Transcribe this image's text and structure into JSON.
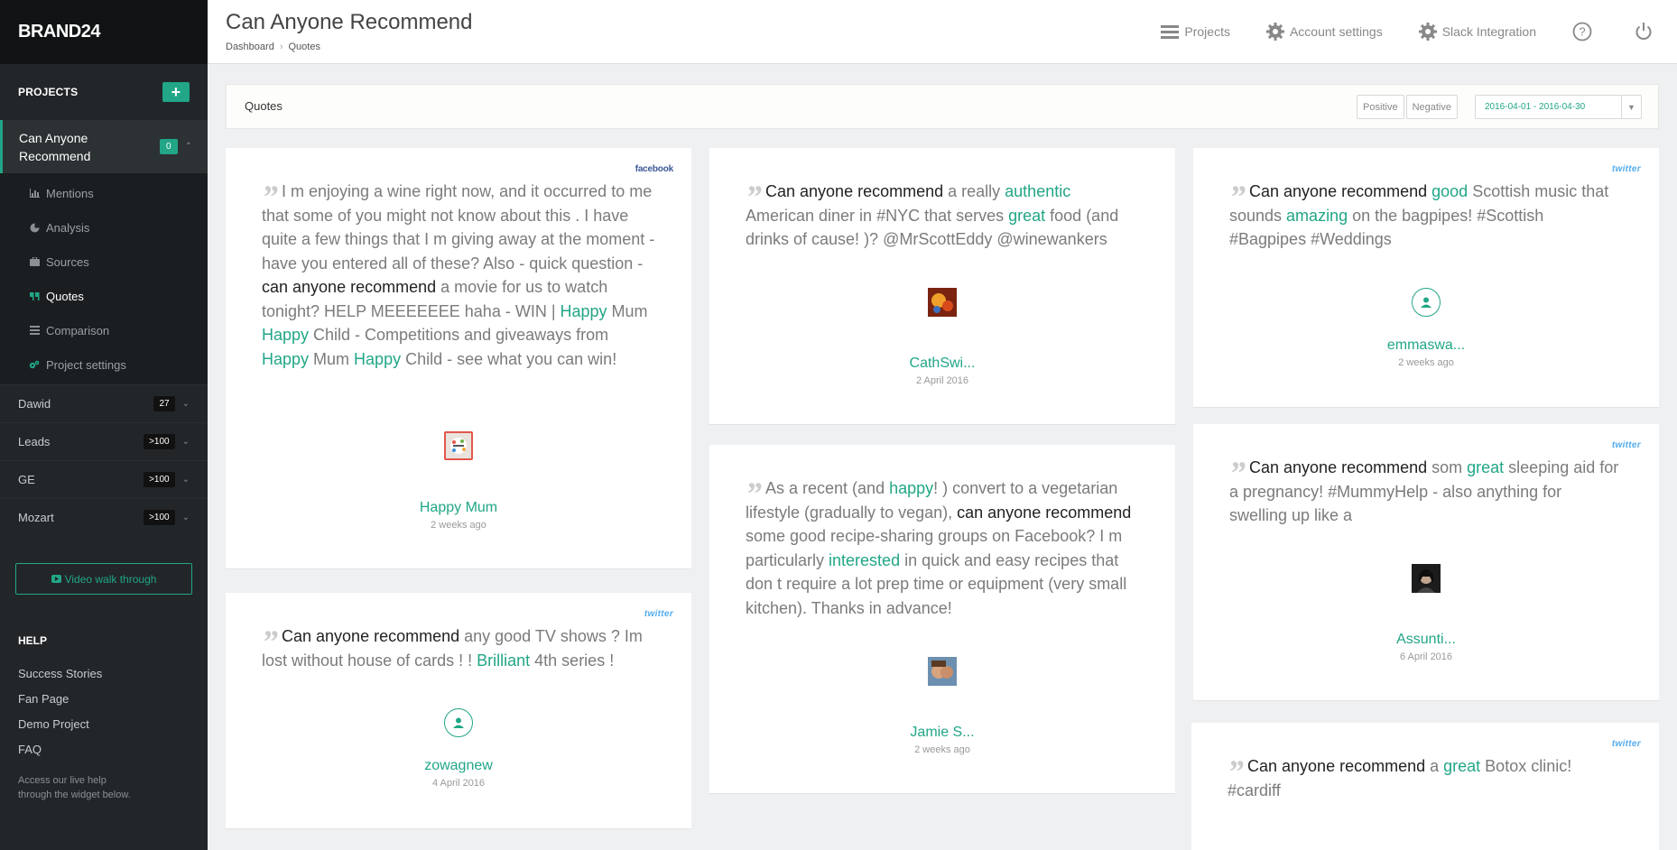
{
  "brand": "BRAND24",
  "sidebar": {
    "projects_heading": "PROJECTS",
    "add_label": "+",
    "active_project": {
      "name": "Can Anyone Recommend",
      "badge": "0"
    },
    "submenu": [
      {
        "label": "Mentions",
        "icon": "bar-chart-icon"
      },
      {
        "label": "Analysis",
        "icon": "pie-chart-icon"
      },
      {
        "label": "Sources",
        "icon": "briefcase-icon"
      },
      {
        "label": "Quotes",
        "icon": "quote-icon"
      },
      {
        "label": "Comparison",
        "icon": "list-icon"
      },
      {
        "label": "Project settings",
        "icon": "gears-icon"
      }
    ],
    "projects": [
      {
        "name": "Dawid",
        "badge": "27"
      },
      {
        "name": "Leads",
        "badge": ">100"
      },
      {
        "name": "GE",
        "badge": ">100"
      },
      {
        "name": "Mozart",
        "badge": ">100"
      }
    ],
    "video_label": "Video walk through",
    "help_heading": "HELP",
    "help_links": [
      "Success Stories",
      "Fan Page",
      "Demo Project",
      "FAQ"
    ],
    "help_note": "Access our live help through the widget below."
  },
  "header": {
    "title": "Can Anyone Recommend",
    "breadcrumb": [
      "Dashboard",
      "Quotes"
    ],
    "nav": {
      "projects": "Projects",
      "account": "Account settings",
      "slack": "Slack Integration"
    }
  },
  "filter": {
    "title": "Quotes",
    "positive": "Positive",
    "negative": "Negative",
    "date_range": "2016-04-01 - 2016-04-30"
  },
  "quotes": [
    {
      "source": "facebook",
      "author": "Happy Mum",
      "date": "2 weeks ago"
    },
    {
      "source": "twitter",
      "author": "zowagnew",
      "date": "4 April 2016"
    },
    {
      "source": "",
      "author": "CathSwi...",
      "date": "2 April 2016"
    },
    {
      "source": "",
      "author": "Jamie S...",
      "date": "2 weeks ago"
    },
    {
      "source": "twitter",
      "author": "emmaswa...",
      "date": "2 weeks ago"
    },
    {
      "source": "twitter",
      "author": "Assunti...",
      "date": "6 April 2016"
    },
    {
      "source": "twitter",
      "author": "",
      "date": ""
    }
  ],
  "quote_texts": {
    "q0": [
      {
        "t": "I m enjoying a wine right now, and it occurred to me that some of you might not know about this . I have quite a few things that I m giving away at the moment - have you entered all of these? Also - quick question - "
      },
      {
        "b": "can anyone recommend"
      },
      {
        "t": " a movie for us to watch tonight? HELP MEEEEEEE haha - WIN | "
      },
      {
        "g": "Happy"
      },
      {
        "t": " Mum "
      },
      {
        "g": "Happy"
      },
      {
        "t": " Child - Competitions and giveaways from "
      },
      {
        "g": "Happy"
      },
      {
        "t": " Mum "
      },
      {
        "g": "Happy"
      },
      {
        "t": " Child - see what you can win!"
      }
    ],
    "q1": [
      {
        "b": "Can anyone recommend"
      },
      {
        "t": " any good TV shows ? Im lost without house of cards ! ! "
      },
      {
        "g": "Brilliant"
      },
      {
        "t": " 4th series !"
      }
    ],
    "q2": [
      {
        "b": "Can anyone recommend"
      },
      {
        "t": " a really "
      },
      {
        "g": "authentic"
      },
      {
        "t": " American diner in #NYC that serves "
      },
      {
        "g": "great"
      },
      {
        "t": " food (and drinks of cause! )? @MrScottEddy @winewankers"
      }
    ],
    "q3": [
      {
        "t": "As a recent (and "
      },
      {
        "g": "happy"
      },
      {
        "t": "! ) convert to a vegetarian lifestyle (gradually to vegan), "
      },
      {
        "b": "can anyone recommend"
      },
      {
        "t": " some good recipe-sharing groups on Facebook? I m particularly "
      },
      {
        "g": "interested"
      },
      {
        "t": " in quick and easy recipes that don t require a lot prep time or equipment (very small kitchen). Thanks in advance!"
      }
    ],
    "q4": [
      {
        "b": "Can anyone recommend"
      },
      {
        "t": " "
      },
      {
        "g": "good"
      },
      {
        "t": " Scottish music that sounds "
      },
      {
        "g": "amazing"
      },
      {
        "t": " on the bagpipes! #Scottish #Bagpipes #Weddings"
      }
    ],
    "q5": [
      {
        "b": "Can anyone recommend"
      },
      {
        "t": " som "
      },
      {
        "g": "great"
      },
      {
        "t": " sleeping aid for a pregnancy! #MummyHelp - also anything for swelling up like a"
      }
    ],
    "q6": [
      {
        "b": "Can anyone recommend"
      },
      {
        "t": " a "
      },
      {
        "g": "great"
      },
      {
        "t": " Botox clinic! #cardiff"
      }
    ]
  },
  "colors": {
    "accent": "#21a687",
    "sidebar": "#222629",
    "facebook": "#3b5998",
    "twitter": "#55acee"
  }
}
